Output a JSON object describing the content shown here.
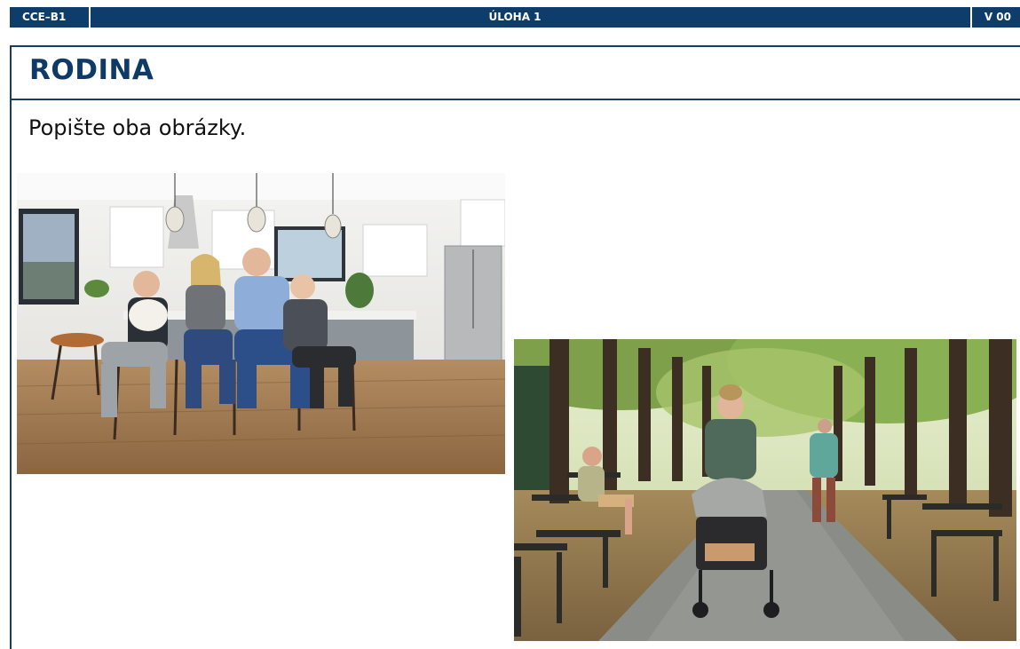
{
  "header": {
    "code": "CCE–B1",
    "task": "ÚLOHA 1",
    "version": "V 00"
  },
  "page": {
    "title": "RODINA",
    "instruction": "Popište oba obrázky."
  },
  "images": [
    {
      "name": "family-kitchen-photo"
    },
    {
      "name": "park-stroller-photo"
    }
  ]
}
